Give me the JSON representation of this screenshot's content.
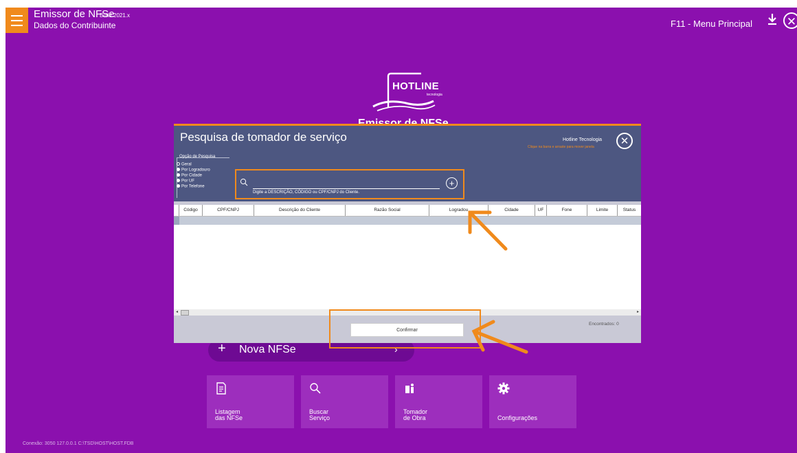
{
  "app": {
    "title": "Emissor de NFSe",
    "build": "Build 2021.x",
    "subtitle": "Dados do Contribuinte",
    "menu_shortcut": "F11 - Menu Principal",
    "logo_text": "HOTLINE",
    "logo_subtext": "tecnologia",
    "background_title_peek": "Emissor de NFSe"
  },
  "home": {
    "nova_label": "Nova NFSe",
    "nova_plus": "+",
    "nova_arrow": "›",
    "tiles": [
      {
        "icon": "document-list-icon",
        "label_line1": "Listagem",
        "label_line2": "das NFSe"
      },
      {
        "icon": "search-icon",
        "label_line1": "Buscar",
        "label_line2": "Serviço"
      },
      {
        "icon": "worker-icon",
        "label_line1": "Tomador",
        "label_line2": "de Obra"
      },
      {
        "icon": "gear-icon",
        "label_line1": "Configurações",
        "label_line2": ""
      }
    ],
    "footer": "Conexão: 3050  127.0.0.1  C:\\TSD\\HOST\\HOST.FDB"
  },
  "dialog": {
    "title": "Pesquisa de tomador de serviço",
    "company": "Hotline Tecnologia",
    "move_hint": "Clique na barra e arraste para mover janela",
    "close": "✕",
    "search_options_title": "Opção de Pesquisa",
    "search_options": [
      {
        "label": "Geral",
        "selected": false
      },
      {
        "label": "Por Logradouro",
        "selected": true
      },
      {
        "label": "Por Cidade",
        "selected": true
      },
      {
        "label": "Por UF",
        "selected": true
      },
      {
        "label": "Por Telefone",
        "selected": true
      }
    ],
    "search": {
      "value": "",
      "placeholder": "",
      "help": "Digite a DESCRIÇÃO, CÓDIGO ou CPF/CNPJ do Cliente.",
      "add": "+"
    },
    "table": {
      "columns": [
        "Código",
        "CPF/CNPJ",
        "Descrição do Cliente",
        "Razão Social",
        "Logradou",
        "Cidade",
        "UF",
        "Fone",
        "Limite",
        "Status"
      ],
      "rows": []
    },
    "found": "Encontrados: 0",
    "confirm": "Confirmar",
    "hscroll_left": "◂",
    "hscroll_right": "▸"
  },
  "colors": {
    "background": "#8b10ae",
    "accent": "#f08a1c",
    "dialog_header": "#4d5781",
    "tile": "#9d2ebd"
  }
}
